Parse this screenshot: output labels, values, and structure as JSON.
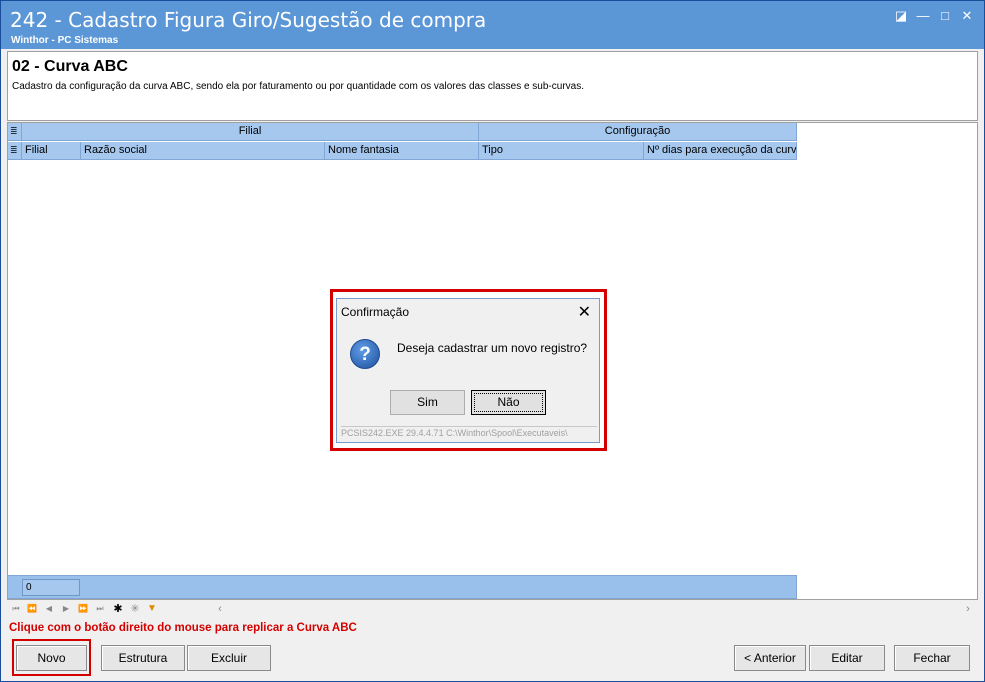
{
  "window": {
    "title": "242 - Cadastro Figura Giro/Sugestão de compra",
    "subtitle": "Winthor - PC Sistemas",
    "controls": [
      "◪",
      "—",
      "□",
      "✕"
    ]
  },
  "header": {
    "title": "02 - Curva ABC",
    "description": "Cadastro da configuração da curva ABC, sendo ela por faturamento ou por quantidade com os valores das classes e sub-curvas."
  },
  "grid": {
    "bands": [
      "Filial",
      "Configuração"
    ],
    "columns": [
      "Filial",
      "Razão social",
      "Nome fantasia",
      "Tipo",
      "Nº dias para execução da curv"
    ],
    "footer_count": "0"
  },
  "hint": "Clique com o botão direito do mouse para replicar a Curva ABC",
  "buttons": {
    "novo": "Novo",
    "estrutura": "Estrutura",
    "excluir": "Excluir",
    "anterior": "< Anterior",
    "editar": "Editar",
    "fechar": "Fechar"
  },
  "dialog": {
    "title": "Confirmação",
    "message": "Deseja cadastrar um novo registro?",
    "yes": "Sim",
    "no": "Não",
    "status": "PCSIS242.EXE 29.4.4.71 C:\\Winthor\\Spool\\Executaveis\\"
  },
  "colors": {
    "titlebar": "#5b96d6",
    "grid_header": "#a6c8ee",
    "highlight": "#d40000"
  }
}
